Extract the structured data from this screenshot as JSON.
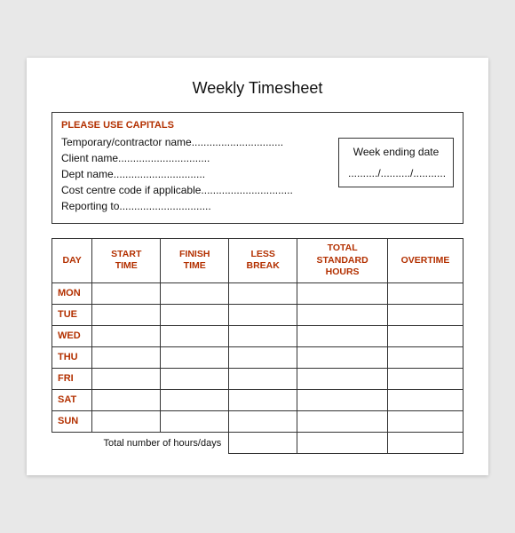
{
  "title": "Weekly Timesheet",
  "infoBox": {
    "headerNote": "PLEASE USE CAPITALS",
    "fields": [
      "Temporary/contractor name...............................",
      "Client name...............................",
      "Dept name...............................",
      "Cost centre code if applicable...............................",
      "Reporting to..............................."
    ],
    "weekEndingLabel": "Week ending date",
    "weekEndingValue": "........../........../..........."
  },
  "table": {
    "headers": [
      "DAY",
      "START TIME",
      "FINISH TIME",
      "LESS BREAK",
      "TOTAL STANDARD HOURS",
      "OVERTIME"
    ],
    "days": [
      "MON",
      "TUE",
      "WED",
      "THU",
      "FRI",
      "SAT",
      "SUN"
    ],
    "totalLabel": "Total number of hours/days"
  }
}
